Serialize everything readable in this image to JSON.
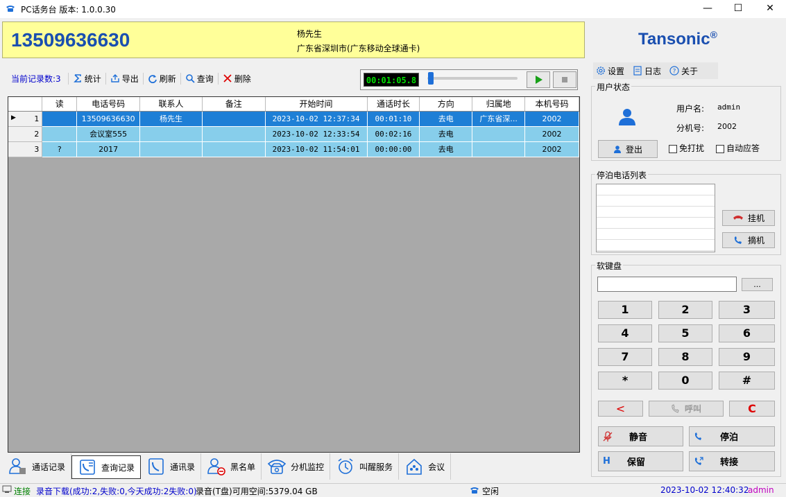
{
  "window": {
    "title": "PC话务台  版本: 1.0.0.30",
    "minimize": "—",
    "maximize": "☐",
    "close": "✕"
  },
  "caller": {
    "number": "13509636630",
    "name": "杨先生",
    "location": "广东省深圳市(广东移动全球通卡)"
  },
  "logo": {
    "text": "Tansonic",
    "mark": "®"
  },
  "toolbar": {
    "record_count": "当前记录数:3",
    "stats": "统计",
    "export": "导出",
    "refresh": "刷新",
    "query": "查询",
    "delete": "删除"
  },
  "player": {
    "time": "00:01:05.8",
    "progress": 0.02
  },
  "table": {
    "columns": [
      "读",
      "电话号码",
      "联系人",
      "备注",
      "开始时间",
      "通话时长",
      "方向",
      "归属地",
      "本机号码"
    ],
    "rows": [
      {
        "idx": "1",
        "read": "",
        "phone": "13509636630",
        "contact": "杨先生",
        "note": "",
        "start": "2023-10-02 12:37:34",
        "duration": "00:01:10",
        "direction": "去电",
        "region": "广东省深...",
        "local": "2002",
        "selected": true
      },
      {
        "idx": "2",
        "read": "",
        "phone": "会议室555",
        "contact": "",
        "note": "",
        "start": "2023-10-02 12:33:54",
        "duration": "00:02:16",
        "direction": "去电",
        "region": "",
        "local": "2002",
        "selected": false
      },
      {
        "idx": "3",
        "read": "?",
        "phone": "2017",
        "contact": "",
        "note": "",
        "start": "2023-10-02 11:54:01",
        "duration": "00:00:00",
        "direction": "去电",
        "region": "",
        "local": "2002",
        "selected": false
      }
    ]
  },
  "tabs": [
    {
      "label": "通话记录",
      "icon": "user-record-icon"
    },
    {
      "label": "查询记录",
      "icon": "query-record-icon",
      "active": true
    },
    {
      "label": "通讯录",
      "icon": "phonebook-icon"
    },
    {
      "label": "黑名单",
      "icon": "blacklist-icon"
    },
    {
      "label": "分机监控",
      "icon": "extension-monitor-icon"
    },
    {
      "label": "叫醒服务",
      "icon": "alarm-clock-icon"
    },
    {
      "label": "会议",
      "icon": "conference-icon"
    }
  ],
  "status": {
    "connection": "连接",
    "download": "录音下载(成功:2,失败:0,今天成功:2失败:0)",
    "storage": "录音(T盘)可用空间:5379.04 GB",
    "line_state": "空闲",
    "datetime": "2023-10-02 12:40:32",
    "user": "admin"
  },
  "right_menu": {
    "settings": "设置",
    "log": "日志",
    "about": "关于"
  },
  "user_status": {
    "title": "用户状态",
    "username_label": "用户名:",
    "username": "admin",
    "ext_label": "分机号:",
    "ext": "2002",
    "logout": "登出",
    "dnd": "免打扰",
    "auto_answer": "自动应答"
  },
  "park": {
    "title": "停泊电话列表",
    "hangup": "挂机",
    "pickup": "摘机"
  },
  "keypad": {
    "title": "软键盘",
    "input_value": "",
    "more": "...",
    "keys": [
      "1",
      "2",
      "3",
      "4",
      "5",
      "6",
      "7",
      "8",
      "9",
      "*",
      "0",
      "#"
    ],
    "back": "<",
    "call": "呼叫",
    "clear": "C"
  },
  "actions": {
    "mute": "静音",
    "park": "停泊",
    "hold": "保留",
    "transfer": "转接"
  },
  "colors": {
    "accent": "#1a4fb0",
    "selected_row": "#1e7fd6",
    "row": "#87ceeb",
    "caller_bg": "#ffff99"
  }
}
